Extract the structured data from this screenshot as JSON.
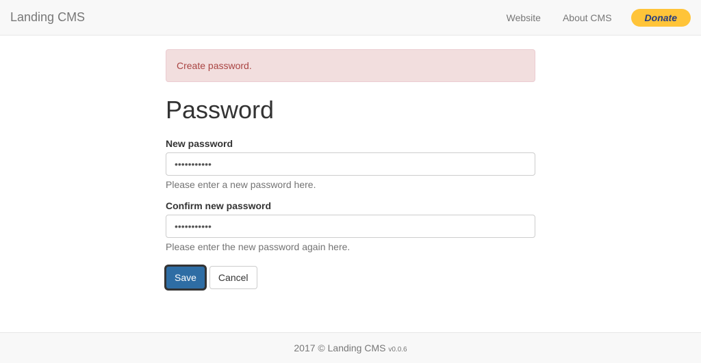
{
  "navbar": {
    "brand": "Landing CMS",
    "links": {
      "website": "Website",
      "about": "About CMS"
    },
    "donate": "Donate"
  },
  "alert": {
    "message": "Create password."
  },
  "page": {
    "title": "Password"
  },
  "form": {
    "new_password": {
      "label": "New password",
      "value": "•••••••••••",
      "help": "Please enter a new password here."
    },
    "confirm_password": {
      "label": "Confirm new password",
      "value": "•••••••••••",
      "help": "Please enter the new password again here."
    },
    "save": "Save",
    "cancel": "Cancel"
  },
  "footer": {
    "copyright": "2017 © Landing CMS ",
    "version": "v0.0.6"
  }
}
